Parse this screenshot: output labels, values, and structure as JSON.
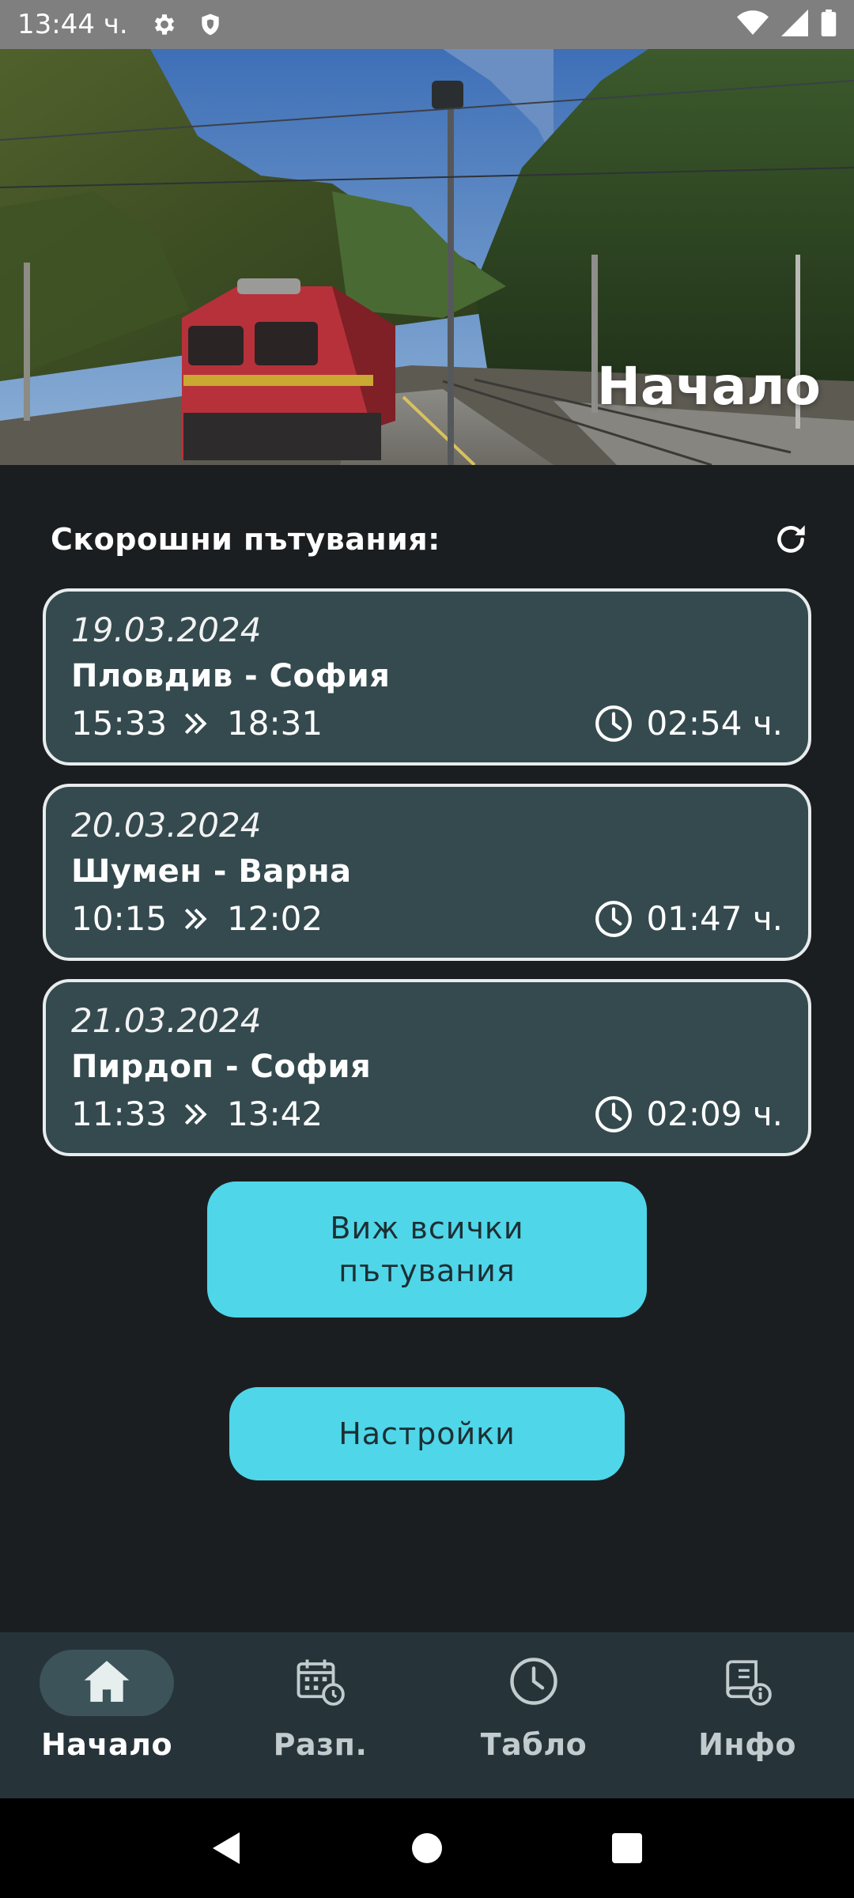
{
  "status_bar": {
    "time": "13:44 ч."
  },
  "hero": {
    "title": "Начало"
  },
  "recent": {
    "title": "Скорошни пътувания:",
    "trips": [
      {
        "date": "19.03.2024",
        "route": "Пловдив - София",
        "departure": "15:33",
        "arrival": "18:31",
        "duration": "02:54 ч."
      },
      {
        "date": "20.03.2024",
        "route": "Шумен - Варна",
        "departure": "10:15",
        "arrival": "12:02",
        "duration": "01:47 ч."
      },
      {
        "date": "21.03.2024",
        "route": "Пирдоп - София",
        "departure": "11:33",
        "arrival": "13:42",
        "duration": "02:09 ч."
      }
    ]
  },
  "buttons": {
    "all_trips_line1": "Виж всички",
    "all_trips_line2": "пътувания",
    "settings": "Настройки"
  },
  "nav": {
    "items": [
      {
        "label": "Начало",
        "icon": "home-icon",
        "active": true
      },
      {
        "label": "Разп.",
        "icon": "calendar-clock-icon",
        "active": false
      },
      {
        "label": "Табло",
        "icon": "clock-icon",
        "active": false
      },
      {
        "label": "Инфо",
        "icon": "info-book-icon",
        "active": false
      }
    ]
  },
  "colors": {
    "background": "#1b1e20",
    "card": "#344a4e",
    "accent": "#4fd6e9",
    "nav_bar": "#26343a"
  }
}
